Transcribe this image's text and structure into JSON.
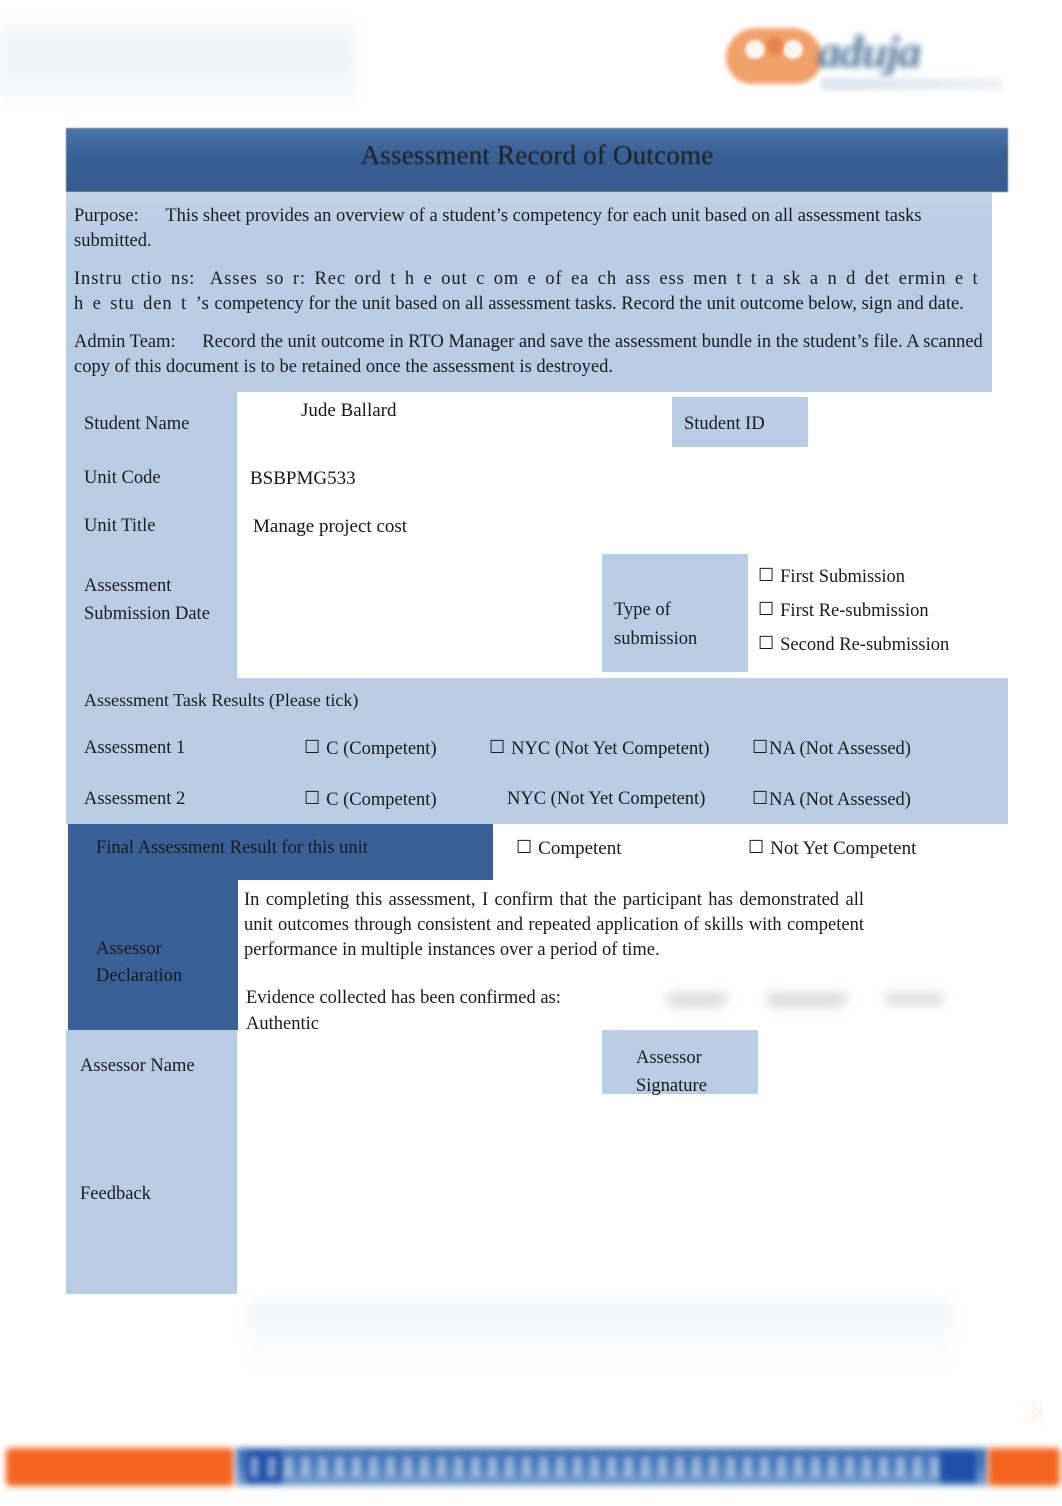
{
  "document": {
    "title": "Assessment Record of Outcome",
    "page_number": "3"
  },
  "logo": {
    "wordmark": "aduja",
    "mark_color": "#f0a06a",
    "word_color": "#4a7298"
  },
  "intro": {
    "purpose_label": "Purpose:",
    "purpose_text": "This sheet provides an overview of a student’s competency for each unit based on all assessment tasks submitted.",
    "instructions_label": "Instru ctio ns:",
    "instructions_text": "Asses so r:  Rec ord  t h e  out c om e   of  ea ch  ass ess men t  t a sk  a n d  det ermin e  t h e   stu den t ’s",
    "instructions_text2": "competency for the unit based on all assessment tasks. Record the unit outcome below, sign and date.",
    "admin_label": "Admin Team:",
    "admin_text": "Record the unit outcome in RTO Manager and save the assessment bundle in the student’s file. A scanned copy of this document is to be retained once the assessment is destroyed."
  },
  "fields": {
    "student_name_label": "Student Name",
    "student_name_value": "Jude Ballard",
    "student_id_label": "Student    ID",
    "student_id_value": "",
    "unit_code_label": "Unit Code",
    "unit_code_value": "BSBPMG533",
    "unit_title_label": "Unit Title",
    "unit_title_value": "Manage project cost",
    "submission_date_label": "Assessment Submission Date",
    "submission_date_value": "",
    "type_of_submission_label": "Type                of submission",
    "submission_options": [
      "First Submission",
      "First Re-submission",
      "Second Re-submission"
    ]
  },
  "task_results": {
    "heading": "Assessment Task Results (Please tick)",
    "rows": [
      {
        "name": "Assessment 1",
        "competent": "C (Competent)",
        "competent_has_box": true,
        "nyc": "NYC (Not Yet Competent)",
        "nyc_has_box": true,
        "na": "NA (Not Assessed)",
        "na_has_box": true
      },
      {
        "name": "Assessment 2",
        "competent": "C (Competent)",
        "competent_has_box": true,
        "nyc": "NYC (Not Yet Competent)",
        "nyc_has_box": false,
        "na": "NA (Not Assessed)",
        "na_has_box": true
      }
    ]
  },
  "final_result": {
    "label": "Final Assessment Result for this unit",
    "options": [
      "Competent",
      "Not Yet Competent"
    ]
  },
  "assessor_declaration": {
    "label": "Assessor Declaration",
    "paragraph": "In completing this assessment, I confirm that the participant has demonstrated all unit outcomes through consistent and repeated application of skills with competent performance in multiple instances over a period of time.",
    "evidence_line": "Evidence  collected  has  been  confirmed  as:",
    "evidence_value": "Authentic"
  },
  "assessor": {
    "name_label": "Assessor Name",
    "name_value": "",
    "signature_label": "Assessor Signature",
    "signature_value": "",
    "feedback_label": "Feedback",
    "feedback_value": ""
  },
  "checkbox_glyph": "☐",
  "colors": {
    "title_bar": "#3a6197",
    "band_light": "#b8cce4",
    "band_dark": "#3a6197",
    "accent_orange": "#f4641e",
    "footer_blue": "#3f6fb5"
  }
}
